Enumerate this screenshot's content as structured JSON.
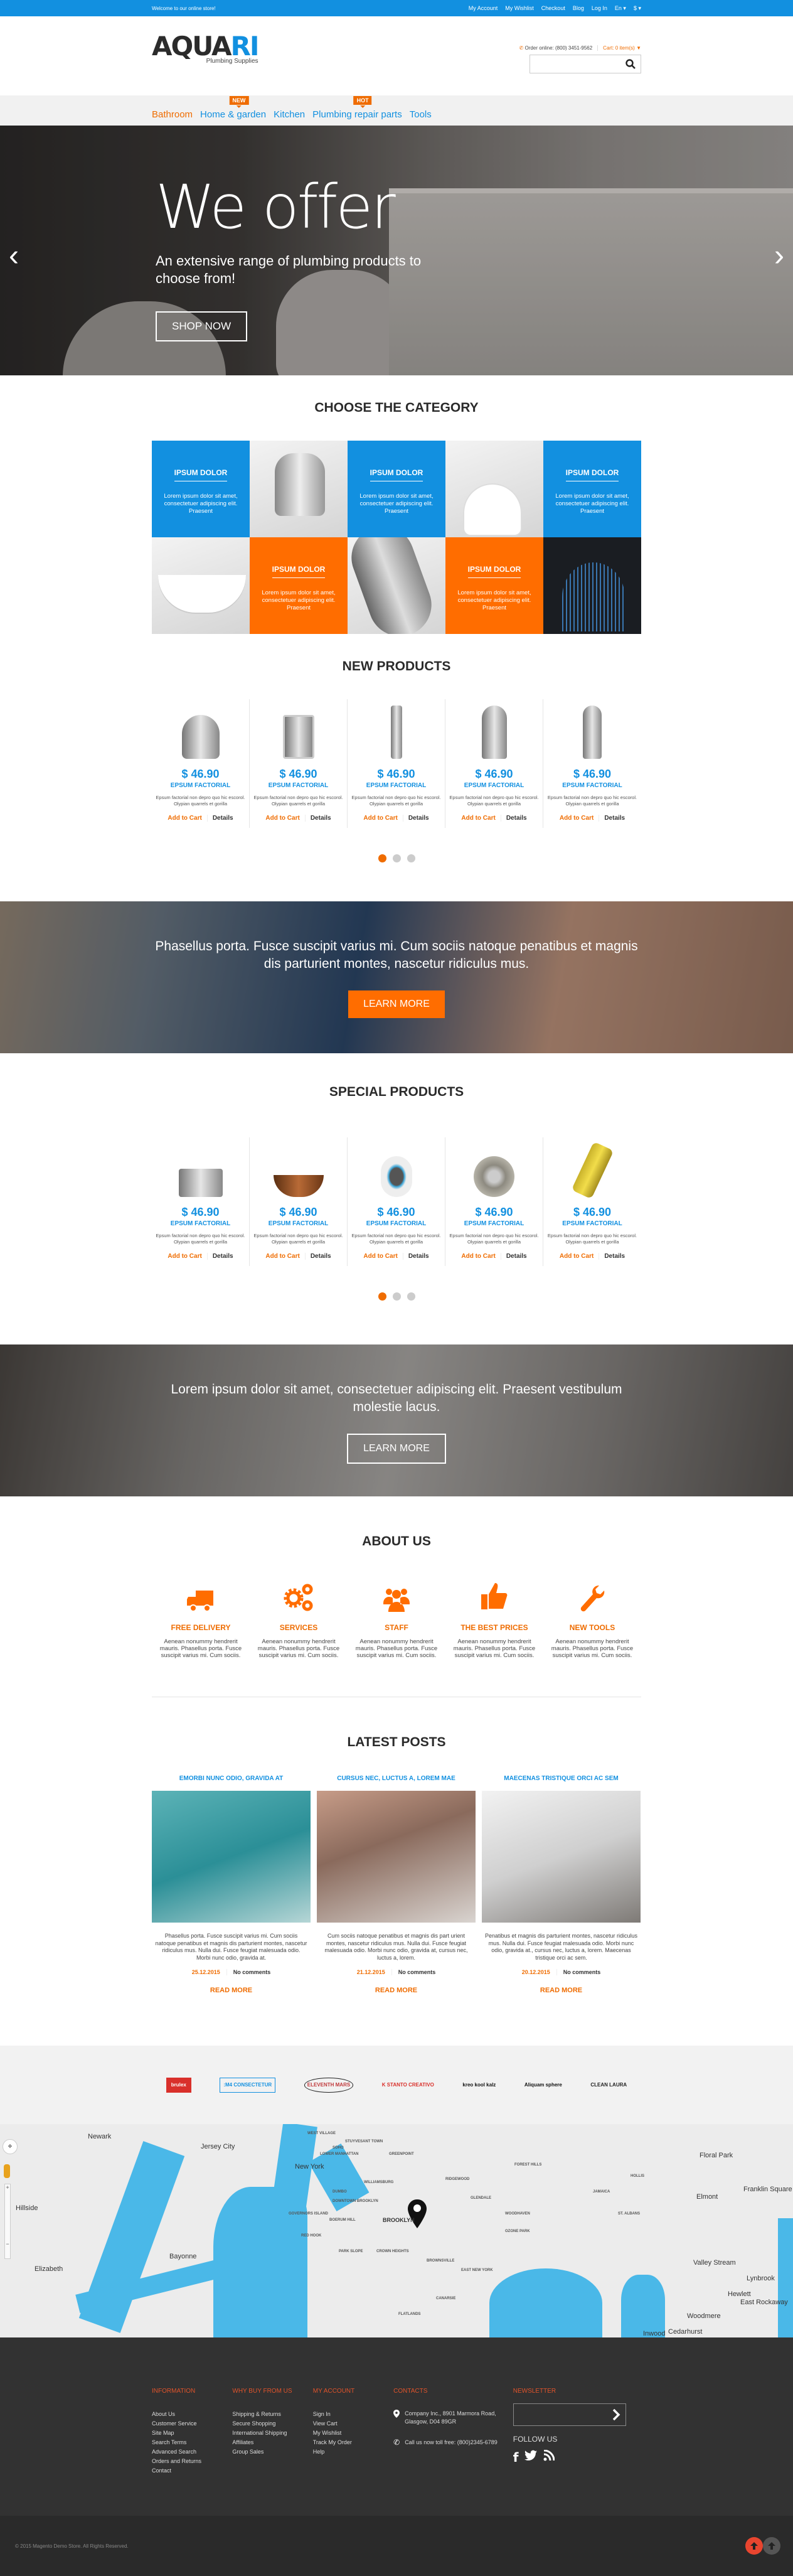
{
  "topbar": {
    "welcome": "Welcome to our online store!",
    "links": [
      "My Account",
      "My Wishlist",
      "Checkout",
      "Blog",
      "Log In"
    ],
    "language": "En",
    "currency": "$"
  },
  "header": {
    "logo_main": "AQUA",
    "logo_accent": "RI",
    "logo_tagline": "Plumbing Supplies",
    "order_online": "Order online: (800) 3451-9562",
    "cart": "Cart: 0 item(s)",
    "search_placeholder": ""
  },
  "nav": {
    "items": [
      {
        "label": "Bathroom",
        "active": true,
        "badge": null
      },
      {
        "label": "Home & garden",
        "active": false,
        "badge": "NEW"
      },
      {
        "label": "Kitchen",
        "active": false,
        "badge": null
      },
      {
        "label": "Plumbing repair parts",
        "active": false,
        "badge": "HOT"
      },
      {
        "label": "Tools",
        "active": false,
        "badge": null
      }
    ]
  },
  "hero": {
    "title": "We offer",
    "subtitle": "An extensive range of plumbing products to choose from!",
    "button": "SHOP NOW",
    "prev": "‹",
    "next": "›"
  },
  "categories": {
    "heading": "CHOOSE THE CATEGORY",
    "tile_title": "IPSUM DOLOR",
    "tile_text": "Lorem ipsum dolor sit amet, consectetuer adipiscing elit. Praesent"
  },
  "new_products": {
    "heading": "NEW PRODUCTS",
    "items": [
      {
        "price": "$ 46.90",
        "name": "EPSUM FACTORIAL",
        "desc": "Epsum factorial non depro quo hic escorol. Olypian quarrels et gorilla",
        "image": "sink-strainer"
      },
      {
        "price": "$ 46.90",
        "name": "EPSUM FACTORIAL",
        "desc": "Epsum factorial non depro quo hic escorol. Olypian quarrels et gorilla",
        "image": "steel-sink"
      },
      {
        "price": "$ 46.90",
        "name": "EPSUM FACTORIAL",
        "desc": "Epsum factorial non depro quo hic escorol. Olypian quarrels et gorilla",
        "image": "soap-dispenser"
      },
      {
        "price": "$ 46.90",
        "name": "EPSUM FACTORIAL",
        "desc": "Epsum factorial non depro quo hic escorol. Olypian quarrels et gorilla",
        "image": "kitchen-faucet"
      },
      {
        "price": "$ 46.90",
        "name": "EPSUM FACTORIAL",
        "desc": "Epsum factorial non depro quo hic escorol. Olypian quarrels et gorilla",
        "image": "spring-faucet"
      }
    ],
    "add_to_cart": "Add to Cart",
    "details": "Details",
    "pages": 3,
    "active_page": 1
  },
  "banner1": {
    "text": "Phasellus porta. Fusce suscipit varius mi. Cum sociis natoque penatibus et magnis dis parturient montes, nascetur ridiculus mus.",
    "button": "LEARN MORE"
  },
  "special_products": {
    "heading": "SPECIAL PRODUCTS",
    "items": [
      {
        "price": "$ 46.90",
        "name": "EPSUM FACTORIAL",
        "desc": "Epsum factorial non depro quo hic escorol. Olypian quarrels et gorilla",
        "image": "pot-filler"
      },
      {
        "price": "$ 46.90",
        "name": "EPSUM FACTORIAL",
        "desc": "Epsum factorial non depro quo hic escorol. Olypian quarrels et gorilla",
        "image": "vessel-sink"
      },
      {
        "price": "$ 46.90",
        "name": "EPSUM FACTORIAL",
        "desc": "Epsum factorial non depro quo hic escorol. Olypian quarrels et gorilla",
        "image": "shower-head"
      },
      {
        "price": "$ 46.90",
        "name": "EPSUM FACTORIAL",
        "desc": "Epsum factorial non depro quo hic escorol. Olypian quarrels et gorilla",
        "image": "drain-strainer"
      },
      {
        "price": "$ 46.90",
        "name": "EPSUM FACTORIAL",
        "desc": "Epsum factorial non depro quo hic escorol. Olypian quarrels et gorilla",
        "image": "pipe-cutter"
      }
    ],
    "add_to_cart": "Add to Cart",
    "details": "Details",
    "pages": 3,
    "active_page": 1
  },
  "banner2": {
    "text": "Lorem ipsum dolor sit amet, consectetuer adipiscing elit. Praesent vestibulum molestie lacus.",
    "button": "LEARN MORE"
  },
  "about": {
    "heading": "ABOUT US",
    "items": [
      {
        "title": "FREE DELIVERY",
        "icon": "truck-icon",
        "text": "Aenean nonummy hendrerit mauris. Phasellus porta. Fusce suscipit varius mi. Cum sociis."
      },
      {
        "title": "SERVICES",
        "icon": "gears-icon",
        "text": "Aenean nonummy hendrerit mauris. Phasellus porta. Fusce suscipit varius mi. Cum sociis."
      },
      {
        "title": "STAFF",
        "icon": "users-icon",
        "text": "Aenean nonummy hendrerit mauris. Phasellus porta. Fusce suscipit varius mi. Cum sociis."
      },
      {
        "title": "THE BEST PRICES",
        "icon": "thumbs-up-icon",
        "text": "Aenean nonummy hendrerit mauris. Phasellus porta. Fusce suscipit varius mi. Cum sociis."
      },
      {
        "title": "NEW TOOLS",
        "icon": "wrench-icon",
        "text": "Aenean nonummy hendrerit mauris. Phasellus porta. Fusce suscipit varius mi. Cum sociis."
      }
    ]
  },
  "posts": {
    "heading": "LATEST POSTS",
    "items": [
      {
        "title": "EMORBI NUNC ODIO, GRAVIDA AT",
        "text": "Phasellus porta. Fusce suscipit varius mi. Cum sociis natoque penatibus et magnis dis parturient montes, nascetur ridiculus mus. Nulla dui. Fusce feugiat malesuada odio. Morbi nunc odio, gravida at.",
        "date": "25.12.2015",
        "comments": "No comments",
        "read_more": "READ MORE"
      },
      {
        "title": "CURSUS NEC, LUCTUS A, LOREM MAE",
        "text": "Cum sociis natoque penatibus et magnis dis part urient montes, nascetur ridiculus mus. Nulla dui. Fusce feugiat malesuada odio. Morbi nunc odio, gravida at, cursus nec, luctus a, lorem.",
        "date": "21.12.2015",
        "comments": "No comments",
        "read_more": "READ MORE"
      },
      {
        "title": "MAECENAS TRISTIQUE ORCI AC SEM",
        "text": "Penatibus et magnis dis parturient montes, nascetur ridiculus mus. Nulla dui. Fusce feugiat malesuada odio. Morbi nunc odio, gravida at., cursus nec, luctus a, lorem. Maecenas tristique orci ac sem.",
        "date": "20.12.2015",
        "comments": "No comments",
        "read_more": "READ MORE"
      }
    ]
  },
  "brands": [
    {
      "label": "brulex",
      "color": "#d9302b"
    },
    {
      "label": ":M4 CONSECTETUR",
      "color": "#1290e0"
    },
    {
      "label": "ELEVENTH MARS",
      "color": "#c0393b"
    },
    {
      "label": "K STANTO CREATIVO",
      "color": "#d9302b"
    },
    {
      "label": "kreo kool kalz",
      "color": "#111111"
    },
    {
      "label": "Aliquam sphere",
      "color": "#111111"
    },
    {
      "label": "CLEAN LAURA",
      "color": "#222222"
    }
  ],
  "map": {
    "labels": [
      "Newark",
      "Jersey City",
      "New York",
      "BROOKLYN",
      "Bayonne",
      "Elizabeth",
      "Hillside",
      "Floral Park",
      "Elmont",
      "Valley Stream",
      "Franklin Square",
      "Lynbrook",
      "Hewlett",
      "East Rockaway",
      "Woodmere",
      "Cedarhurst",
      "Inwood"
    ],
    "small_labels": [
      "WEST VILLAGE",
      "STUYVESANT TOWN",
      "SOHO",
      "LOWER MANHATTAN",
      "GREENPOINT",
      "WILLIAMSBURG",
      "DUMBO",
      "DOWNTOWN BROOKLYN",
      "GOVERNORS ISLAND",
      "BOERUM HILL",
      "RED HOOK",
      "PARK SLOPE",
      "CROWN HEIGHTS",
      "BROWNSVILLE",
      "EAST NEW YORK",
      "FLATLANDS",
      "CANARSIE",
      "RIDGEWOOD",
      "GLENDALE",
      "WOODHAVEN",
      "OZONE PARK",
      "JAMAICA",
      "FOREST HILLS",
      "ST. ALBANS",
      "HOLLIS"
    ]
  },
  "footer": {
    "information": {
      "heading": "INFORMATION",
      "links": [
        "About Us",
        "Customer Service",
        "Site Map",
        "Search Terms",
        "Advanced Search",
        "Orders and Returns",
        "Contact"
      ]
    },
    "why_buy": {
      "heading": "WHY BUY FROM US",
      "links": [
        "Shipping & Returns",
        "Secure Shopping",
        "International Shipping",
        "Affiliates",
        "Group Sales"
      ]
    },
    "my_account": {
      "heading": "MY ACCOUNT",
      "links": [
        "Sign In",
        "View Cart",
        "My Wishlist",
        "Track My Order",
        "Help"
      ]
    },
    "contacts": {
      "heading": "CONTACTS",
      "address": "Company Inc., 8901 Marmora Road, Glasgow, D04 89GR",
      "phone": "Call us now toll free: (800)2345-6789"
    },
    "newsletter": {
      "heading": "NEWSLETTER",
      "placeholder": "",
      "follow": "FOLLOW US"
    },
    "copyright": "© 2015 Magento Demo Store. All Rights Reserved."
  },
  "colors": {
    "blue": "#1290e0",
    "orange": "#ff6d00",
    "footer_bg": "#323232",
    "footer_heading": "#e0532a"
  }
}
